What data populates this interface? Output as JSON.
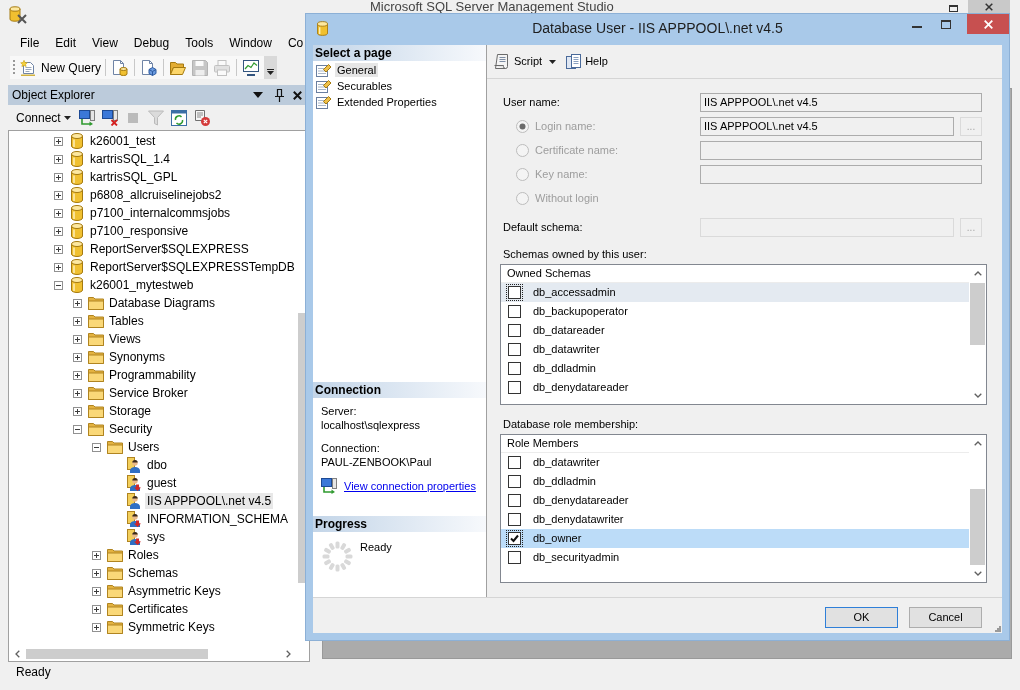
{
  "main_window": {
    "title": "Microsoft SQL Server Management Studio"
  },
  "menu": [
    "File",
    "Edit",
    "View",
    "Debug",
    "Tools",
    "Window",
    "Co"
  ],
  "toolbar": {
    "new_query": "New Query",
    "groups": [
      [
        {
          "kind": "dbquery",
          "disabled": false
        }
      ],
      [
        {
          "kind": "analysisquery",
          "disabled": false
        }
      ],
      [
        {
          "kind": "open",
          "disabled": false
        },
        {
          "kind": "save",
          "disabled": true
        },
        {
          "kind": "print",
          "disabled": true
        }
      ],
      [
        {
          "kind": "monitor",
          "disabled": false
        }
      ]
    ]
  },
  "object_explorer": {
    "title": "Object Explorer",
    "connect": "Connect",
    "tools": [
      {
        "kind": "connect",
        "disabled": false
      },
      {
        "kind": "disconnect",
        "disabled": false
      },
      {
        "kind": "stop",
        "disabled": true
      },
      {
        "kind": "filter",
        "disabled": true
      },
      {
        "kind": "refresh",
        "disabled": false
      },
      {
        "kind": "script",
        "disabled": false
      }
    ],
    "tree": [
      {
        "label": "k26001_test",
        "kind": "database",
        "expanded": false,
        "selected": false
      },
      {
        "label": "kartrisSQL_1.4",
        "kind": "database",
        "expanded": false,
        "selected": false
      },
      {
        "label": "kartrisSQL_GPL",
        "kind": "database",
        "expanded": false,
        "selected": false
      },
      {
        "label": "p6808_allcruiselinejobs2",
        "kind": "database",
        "expanded": false,
        "selected": false
      },
      {
        "label": "p7100_internalcommsjobs",
        "kind": "database",
        "expanded": false,
        "selected": false
      },
      {
        "label": "p7100_responsive",
        "kind": "database",
        "expanded": false,
        "selected": false
      },
      {
        "label": "ReportServer$SQLEXPRESS",
        "kind": "database",
        "expanded": false,
        "selected": false
      },
      {
        "label": "ReportServer$SQLEXPRESSTempDB",
        "kind": "database",
        "expanded": false,
        "selected": false
      },
      {
        "label": "k26001_mytestweb",
        "kind": "database",
        "expanded": true,
        "selected": false,
        "children": [
          {
            "label": "Database Diagrams",
            "kind": "folder",
            "expanded": false,
            "selected": false
          },
          {
            "label": "Tables",
            "kind": "folder",
            "expanded": false,
            "selected": false
          },
          {
            "label": "Views",
            "kind": "folder",
            "expanded": false,
            "selected": false
          },
          {
            "label": "Synonyms",
            "kind": "folder",
            "expanded": false,
            "selected": false
          },
          {
            "label": "Programmability",
            "kind": "folder",
            "expanded": false,
            "selected": false
          },
          {
            "label": "Service Broker",
            "kind": "folder",
            "expanded": false,
            "selected": false
          },
          {
            "label": "Storage",
            "kind": "folder",
            "expanded": false,
            "selected": false
          },
          {
            "label": "Security",
            "kind": "folder",
            "expanded": true,
            "selected": false,
            "children": [
              {
                "label": "Users",
                "kind": "folder",
                "expanded": true,
                "selected": false,
                "children": [
                  {
                    "label": "dbo",
                    "kind": "user",
                    "selected": false
                  },
                  {
                    "label": "guest",
                    "kind": "useroff",
                    "selected": false
                  },
                  {
                    "label": "IIS APPPOOL\\.net v4.5",
                    "kind": "user",
                    "selected": true
                  },
                  {
                    "label": "INFORMATION_SCHEMA",
                    "kind": "useroff",
                    "selected": false
                  },
                  {
                    "label": "sys",
                    "kind": "useroff",
                    "selected": false
                  }
                ]
              },
              {
                "label": "Roles",
                "kind": "folder",
                "expanded": false,
                "selected": false
              },
              {
                "label": "Schemas",
                "kind": "folder",
                "expanded": false,
                "selected": false
              },
              {
                "label": "Asymmetric Keys",
                "kind": "folder",
                "expanded": false,
                "selected": false
              },
              {
                "label": "Certificates",
                "kind": "folder",
                "expanded": false,
                "selected": false
              },
              {
                "label": "Symmetric Keys",
                "kind": "folder",
                "expanded": false,
                "selected": false
              }
            ]
          }
        ]
      }
    ]
  },
  "status_bar": {
    "text": "Ready"
  },
  "dialog": {
    "title": "Database User - IIS APPPOOL\\.net v4.5",
    "pages_header": "Select a page",
    "pages": [
      {
        "label": "General",
        "selected": true
      },
      {
        "label": "Securables",
        "selected": false
      },
      {
        "label": "Extended Properties",
        "selected": false
      }
    ],
    "connection": {
      "header": "Connection",
      "server_label": "Server:",
      "server": "localhost\\sqlexpress",
      "connection_label": "Connection:",
      "connection": "PAUL-ZENBOOK\\Paul",
      "link": "View connection properties"
    },
    "progress": {
      "header": "Progress",
      "status": "Ready"
    },
    "toolbar": {
      "script": "Script",
      "help": "Help"
    },
    "user_name": {
      "label": "User name:",
      "value": "IIS APPPOOL\\.net v4.5"
    },
    "login_types": [
      {
        "label": "Login name:",
        "selected": true,
        "disabled": true,
        "has_field": true,
        "value": "IIS APPPOOL\\.net v4.5",
        "browse": {
          "label": "...",
          "disabled": true
        }
      },
      {
        "label": "Certificate name:",
        "selected": false,
        "disabled": true,
        "has_field": true
      },
      {
        "label": "Key name:",
        "selected": false,
        "disabled": true,
        "has_field": true
      },
      {
        "label": "Without login",
        "selected": false,
        "disabled": true,
        "has_field": false
      }
    ],
    "default_schema": {
      "label": "Default schema:",
      "disabled": true,
      "browse": {
        "label": "...",
        "disabled": true
      }
    },
    "owned_schemas": {
      "label": "Schemas owned by this user:",
      "header": "Owned Schemas",
      "focused": false,
      "rows": [
        {
          "label": "db_accessadmin",
          "checked": false,
          "selected": true
        },
        {
          "label": "db_backupoperator",
          "checked": false,
          "selected": false
        },
        {
          "label": "db_datareader",
          "checked": false,
          "selected": false
        },
        {
          "label": "db_datawriter",
          "checked": false,
          "selected": false
        },
        {
          "label": "db_ddladmin",
          "checked": false,
          "selected": false
        },
        {
          "label": "db_denydatareader",
          "checked": false,
          "selected": false
        }
      ]
    },
    "role_membership": {
      "label": "Database role membership:",
      "header": "Role Members",
      "focused": true,
      "rows": [
        {
          "label": "db_datawriter",
          "checked": false,
          "selected": false
        },
        {
          "label": "db_ddladmin",
          "checked": false,
          "selected": false
        },
        {
          "label": "db_denydatareader",
          "checked": false,
          "selected": false
        },
        {
          "label": "db_denydatawriter",
          "checked": false,
          "selected": false
        },
        {
          "label": "db_owner",
          "checked": true,
          "selected": true
        },
        {
          "label": "db_securityadmin",
          "checked": false,
          "selected": false
        }
      ]
    },
    "buttons": [
      {
        "label": "OK",
        "default": true
      },
      {
        "label": "Cancel",
        "default": false
      }
    ]
  }
}
